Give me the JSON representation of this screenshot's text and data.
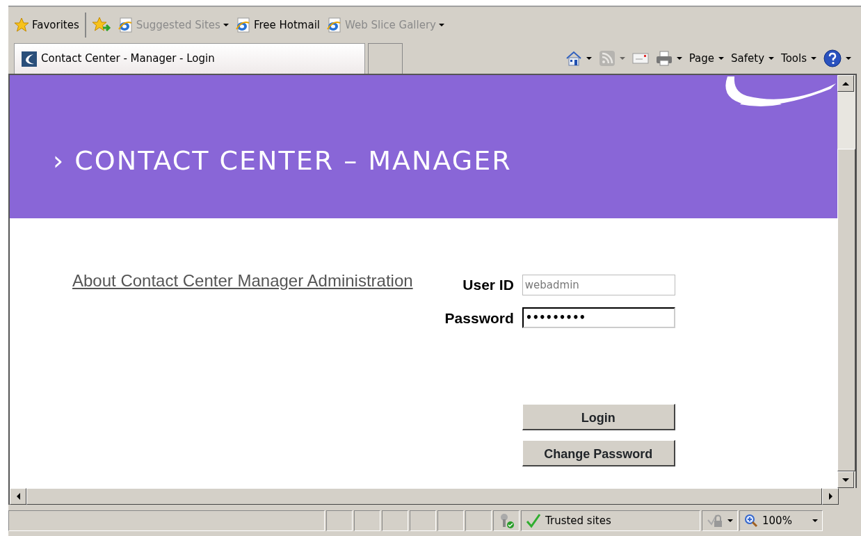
{
  "favorites_bar": {
    "title": "Favorites",
    "items": [
      {
        "kind": "add"
      },
      {
        "kind": "ie",
        "label": "Suggested Sites",
        "dropdown": true,
        "disabled": true
      },
      {
        "kind": "ie",
        "label": "Free Hotmail",
        "dropdown": false,
        "disabled": false
      },
      {
        "kind": "ie",
        "label": "Web Slice Gallery",
        "dropdown": true,
        "disabled": true
      }
    ]
  },
  "tab": {
    "title": "Contact Center - Manager - Login",
    "selected": true
  },
  "command_bar": {
    "tools": [
      {
        "kind": "home",
        "dropdown": true,
        "disabled": false
      },
      {
        "kind": "feed",
        "dropdown": true,
        "disabled": true
      },
      {
        "kind": "mail",
        "dropdown": false,
        "disabled": false
      },
      {
        "kind": "print",
        "dropdown": true,
        "disabled": false
      }
    ],
    "menus": [
      "Page",
      "Safety",
      "Tools"
    ]
  },
  "page": {
    "heading": "› CONTACT CENTER – MANAGER",
    "about_link": "About Contact Center Manager Administration",
    "fields": [
      {
        "label": "User ID",
        "value": "webadmin",
        "focused": false
      },
      {
        "label": "Password",
        "value": "•••••••••",
        "focused": true
      }
    ],
    "buttons": [
      "Login",
      "Change Password"
    ]
  },
  "status_bar": {
    "zone": "Trusted sites",
    "zoom": "100%"
  }
}
